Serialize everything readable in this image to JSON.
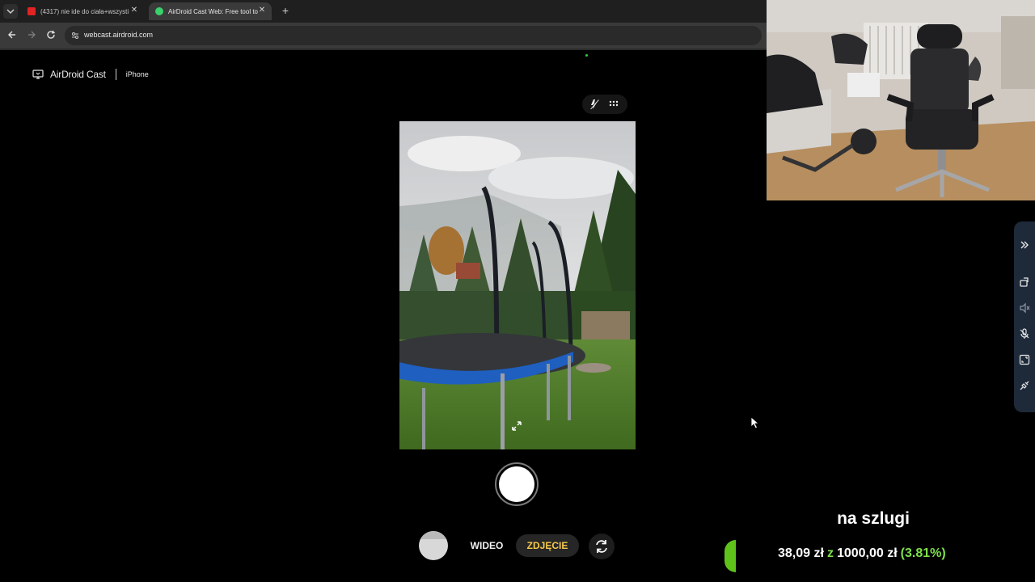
{
  "browser": {
    "tabs": [
      {
        "title": "(4317) nie ide do ciała+wszysti",
        "favicon_color": "#e02424",
        "active": false
      },
      {
        "title": "AirDroid Cast Web: Free tool to",
        "favicon_color": "#3ad16b",
        "active": true
      }
    ],
    "url": "webcast.airdroid.com",
    "icons": {
      "tab_menu": "chevron-down-icon",
      "close": "close-icon",
      "new_tab": "plus-icon",
      "back": "arrow-left-icon",
      "forward": "arrow-right-icon",
      "reload": "reload-icon",
      "site_info": "site-info-icon"
    }
  },
  "app": {
    "brand": "AirDroid Cast",
    "device": "iPhone",
    "status_dot_color": "#2ecc40"
  },
  "camera": {
    "modes": [
      "WIDEO",
      "ZDJĘCIE"
    ],
    "selected_mode": "ZDJĘCIE",
    "selected_color": "#f6c94a",
    "icons": [
      "flash-auto-icon",
      "grid-icon",
      "expand-icon",
      "shutter-icon",
      "gallery-thumbnail",
      "switch-camera-icon"
    ]
  },
  "side_panel": {
    "color": "#1e2a3a",
    "icons": [
      "collapse-icon",
      "rotate-icon",
      "sound-off-icon",
      "mic-off-icon",
      "fullscreen-icon",
      "disconnect-icon"
    ]
  },
  "donation_goal": {
    "title": "na szlugi",
    "current": "38,09 zł",
    "separator": "z",
    "target": "1000,00 zł",
    "percent_text": "(3.81%)",
    "progress_fraction": 0.0381,
    "accent_color": "#7de04a"
  }
}
